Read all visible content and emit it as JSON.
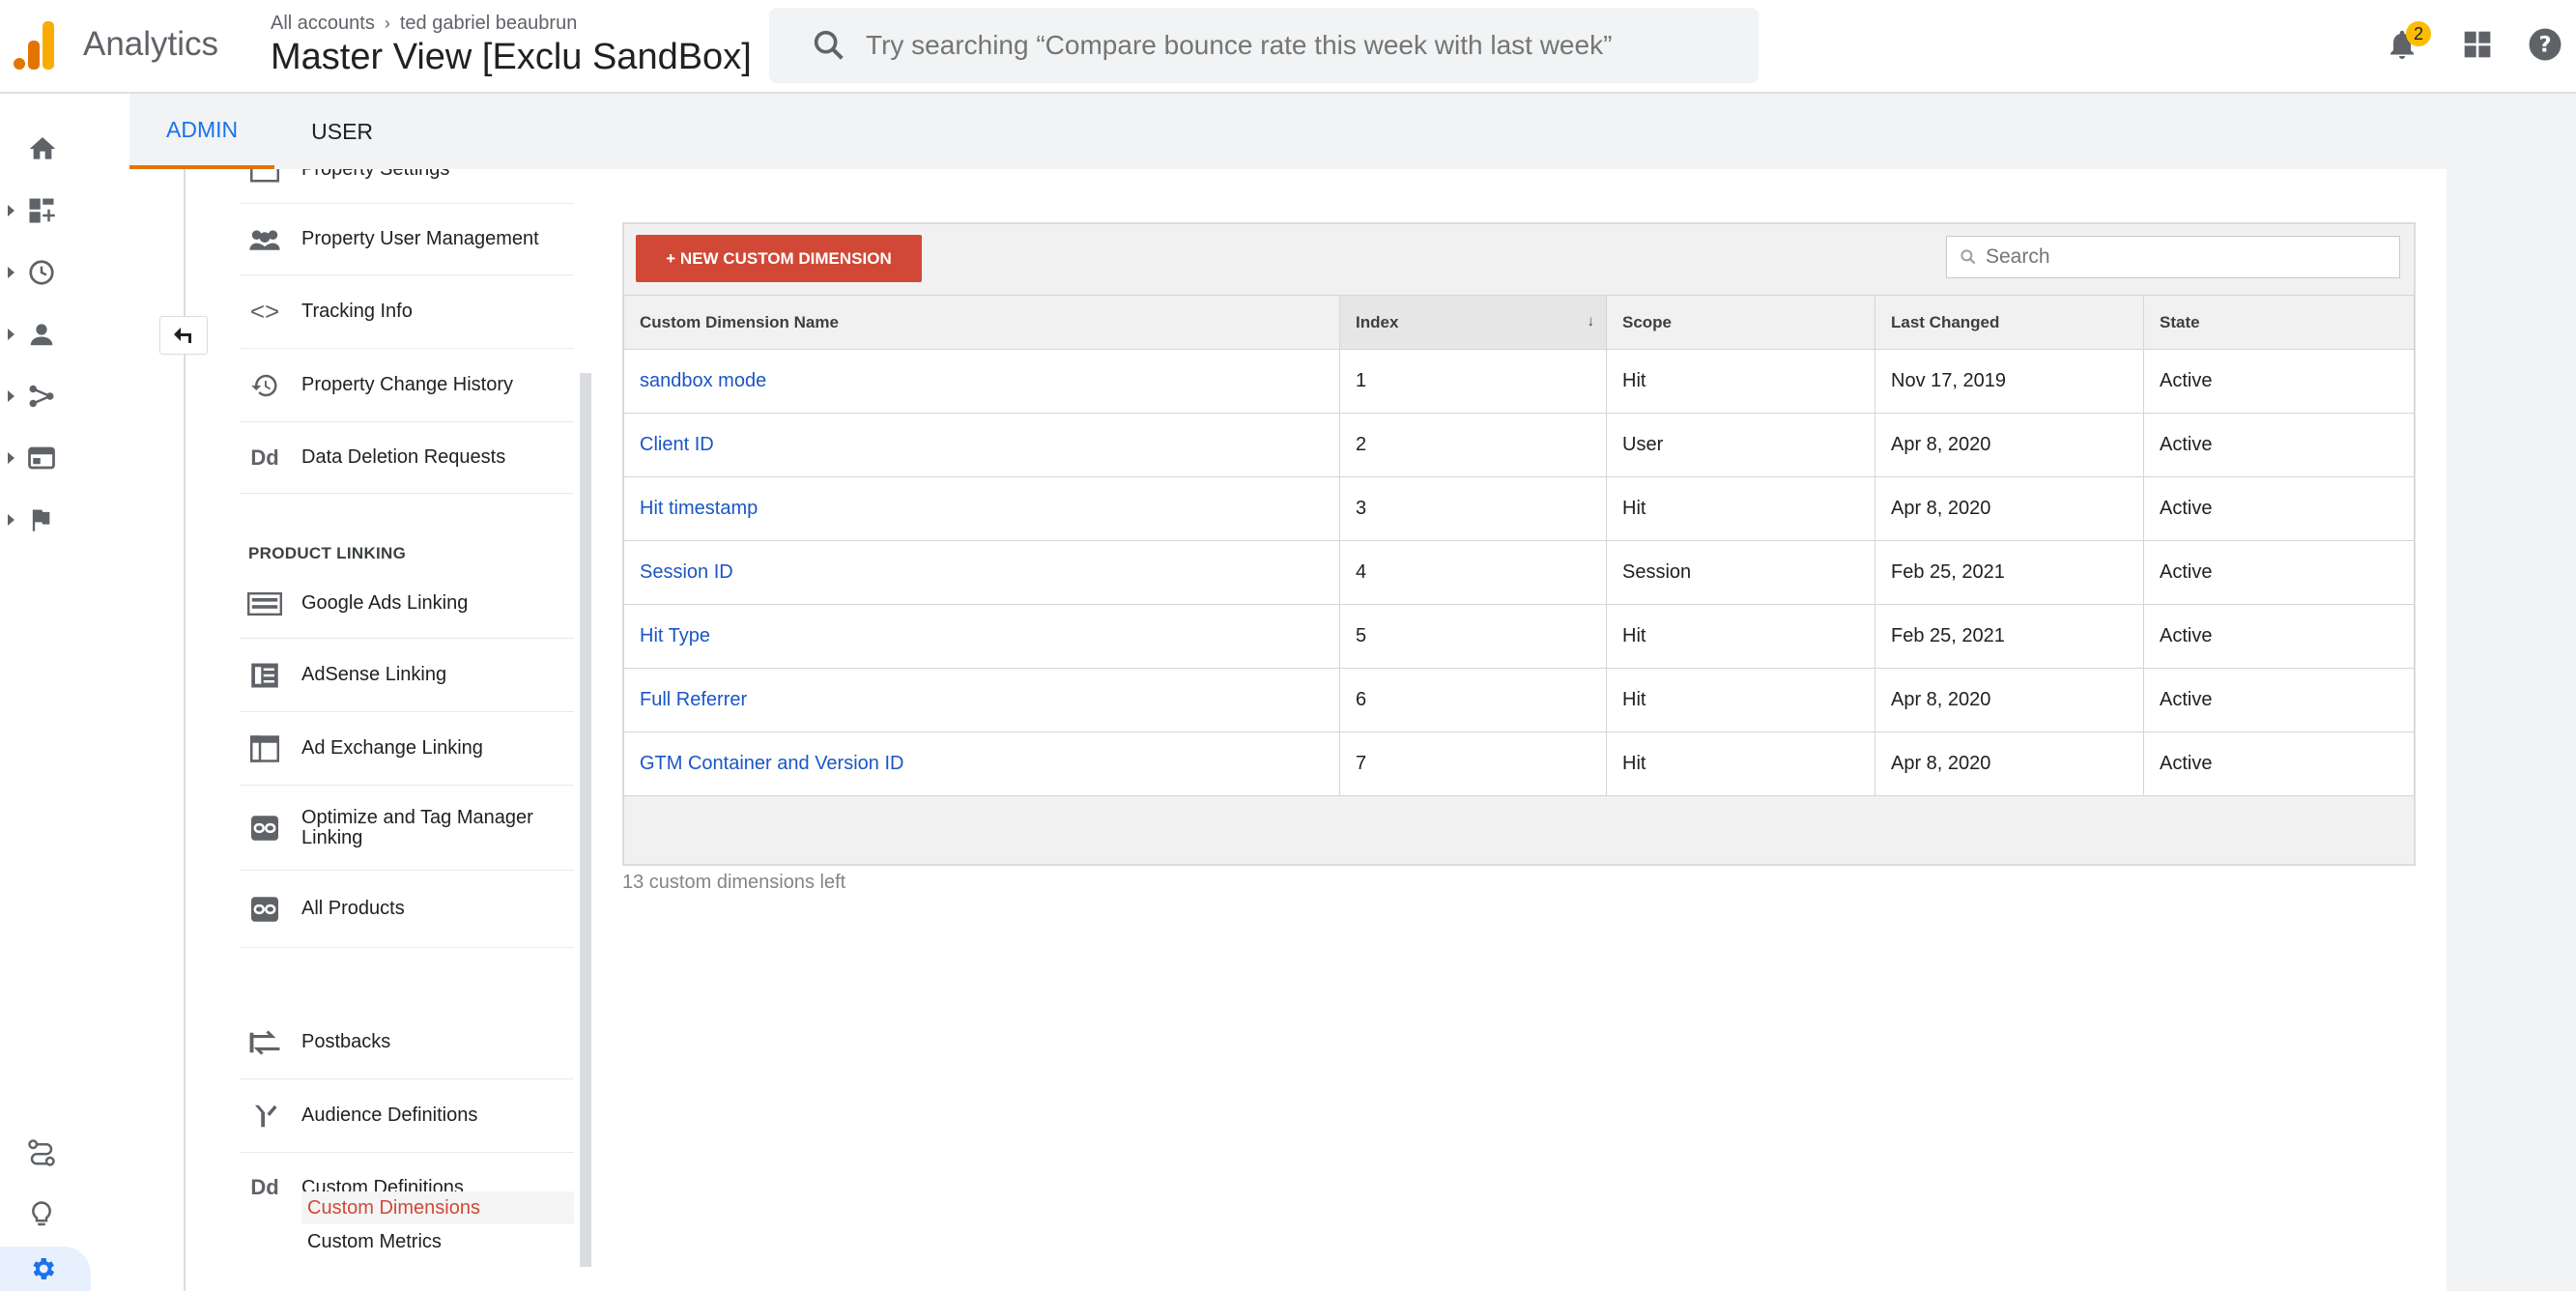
{
  "header": {
    "app_name": "Analytics",
    "breadcrumb_root": "All accounts",
    "breadcrumb_account": "ted gabriel beaubrun",
    "view_name": "Master View [Exclu SandBox]",
    "search_placeholder": "Try searching “Compare bounce rate this week with last week”",
    "notifications_count": "2"
  },
  "tabs": [
    {
      "label": "ADMIN"
    },
    {
      "label": "USER"
    }
  ],
  "nav": {
    "items_top": [
      {
        "label": "Property Settings"
      },
      {
        "label": "Property User Management"
      },
      {
        "label": "Tracking Info"
      },
      {
        "label": "Property Change History"
      },
      {
        "label": "Data Deletion Requests"
      }
    ],
    "section_product_linking": "PRODUCT LINKING",
    "items_linking": [
      {
        "label": "Google Ads Linking"
      },
      {
        "label": "AdSense Linking"
      },
      {
        "label": "Ad Exchange Linking"
      },
      {
        "label": "Optimize and Tag Manager Linking"
      },
      {
        "label": "All Products"
      }
    ],
    "items_bottom": [
      {
        "label": "Postbacks"
      },
      {
        "label": "Audience Definitions"
      },
      {
        "label": "Custom Definitions"
      }
    ],
    "sub_custom_dimensions": "Custom Dimensions",
    "sub_custom_metrics": "Custom Metrics",
    "dd_glyph": "Dd"
  },
  "table": {
    "new_button": "+ NEW CUSTOM DIMENSION",
    "search_placeholder": "Search",
    "columns": [
      "Custom Dimension Name",
      "Index",
      "Scope",
      "Last Changed",
      "State"
    ],
    "rows": [
      {
        "name": "sandbox mode",
        "index": "1",
        "scope": "Hit",
        "changed": "Nov 17, 2019",
        "state": "Active"
      },
      {
        "name": "Client ID",
        "index": "2",
        "scope": "User",
        "changed": "Apr 8, 2020",
        "state": "Active"
      },
      {
        "name": "Hit timestamp",
        "index": "3",
        "scope": "Hit",
        "changed": "Apr 8, 2020",
        "state": "Active"
      },
      {
        "name": "Session ID",
        "index": "4",
        "scope": "Session",
        "changed": "Feb 25, 2021",
        "state": "Active"
      },
      {
        "name": "Hit Type",
        "index": "5",
        "scope": "Hit",
        "changed": "Feb 25, 2021",
        "state": "Active"
      },
      {
        "name": "Full Referrer",
        "index": "6",
        "scope": "Hit",
        "changed": "Apr 8, 2020",
        "state": "Active"
      },
      {
        "name": "GTM Container and Version ID",
        "index": "7",
        "scope": "Hit",
        "changed": "Apr 8, 2020",
        "state": "Active"
      }
    ],
    "footer": "13 custom dimensions left"
  },
  "colors": {
    "accent_blue": "#1a73e8",
    "admin_tab_underline": "#e37400",
    "new_button_bg": "#d14836",
    "link_blue": "#1a56c4",
    "notification_badge": "#fbbc04"
  }
}
